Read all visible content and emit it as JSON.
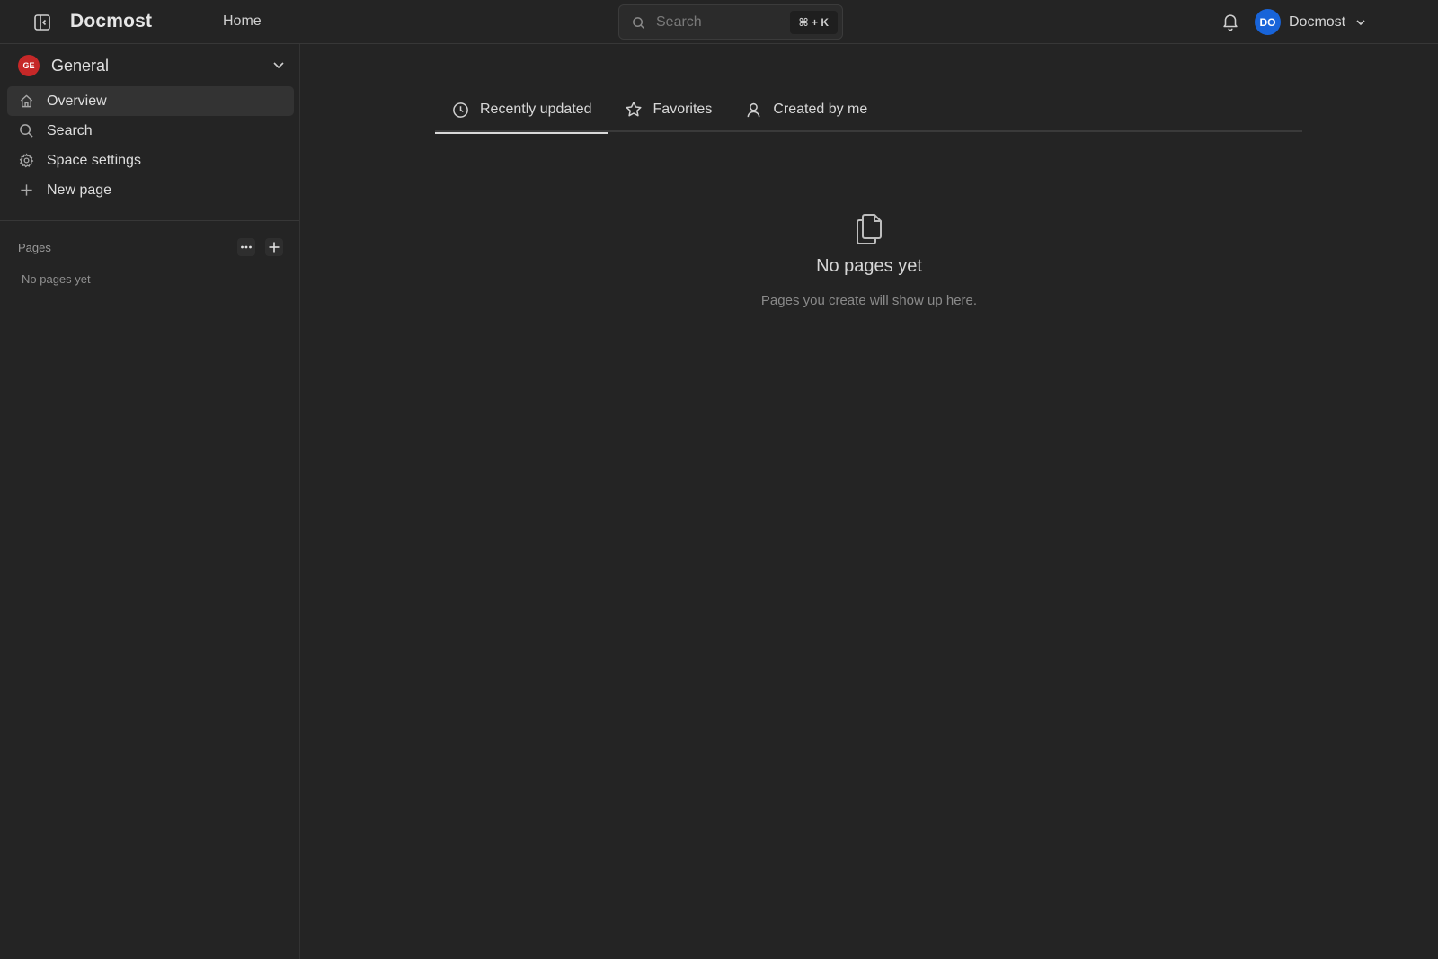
{
  "topbar": {
    "brand": "Docmost",
    "home_label": "Home",
    "search_placeholder": "Search",
    "search_shortcut": "⌘ + K",
    "user_initials": "DO",
    "user_name": "Docmost"
  },
  "sidebar": {
    "space": {
      "initials": "GE",
      "name": "General"
    },
    "nav": [
      {
        "label": "Overview",
        "icon": "home-icon",
        "active": true
      },
      {
        "label": "Search",
        "icon": "search-icon",
        "active": false
      },
      {
        "label": "Space settings",
        "icon": "gear-icon",
        "active": false
      },
      {
        "label": "New page",
        "icon": "plus-icon",
        "active": false
      }
    ],
    "pages_title": "Pages",
    "no_pages": "No pages yet"
  },
  "main": {
    "tabs": [
      {
        "label": "Recently updated",
        "icon": "clock-icon",
        "active": true
      },
      {
        "label": "Favorites",
        "icon": "star-icon",
        "active": false
      },
      {
        "label": "Created by me",
        "icon": "user-icon",
        "active": false
      }
    ],
    "empty": {
      "icon": "files-icon",
      "title": "No pages yet",
      "subtitle": "Pages you create will show up here."
    }
  },
  "colors": {
    "background": "#242424",
    "user_avatar": "#1864d9",
    "space_avatar": "#c62828",
    "active_nav": "#333333"
  }
}
